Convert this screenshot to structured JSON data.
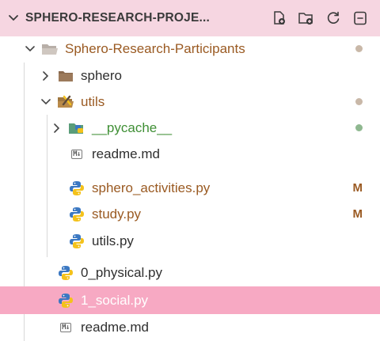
{
  "header": {
    "title": "SPHERO-RESEARCH-PROJE...",
    "actions": [
      "new-file",
      "new-folder",
      "refresh",
      "collapse-all"
    ]
  },
  "tree": {
    "root_folder": {
      "label": "Sphero-Research-Participants",
      "status": "dot"
    },
    "sphero_folder": {
      "label": "sphero"
    },
    "utils_folder": {
      "label": "utils",
      "status": "dot"
    },
    "pycache_folder": {
      "label": "__pycache__",
      "status": "dot"
    },
    "utils_readme": {
      "label": "readme.md",
      "icon_text": "M↓"
    },
    "sphero_activities": {
      "label": "sphero_activities.py",
      "status": "M"
    },
    "study": {
      "label": "study.py",
      "status": "M"
    },
    "utils_py": {
      "label": "utils.py"
    },
    "physical": {
      "label": "0_physical.py"
    },
    "social": {
      "label": "1_social.py",
      "selected": true
    },
    "root_readme": {
      "label": "readme.md",
      "icon_text": "M↓"
    }
  },
  "colors": {
    "header_bg": "#f6d6e1",
    "selected_bg": "#f7a9c3",
    "modified": "#9a5a22",
    "untracked_dot": "#8fb890",
    "python_blue": "#3b78c2",
    "python_yellow": "#f4c21b"
  }
}
